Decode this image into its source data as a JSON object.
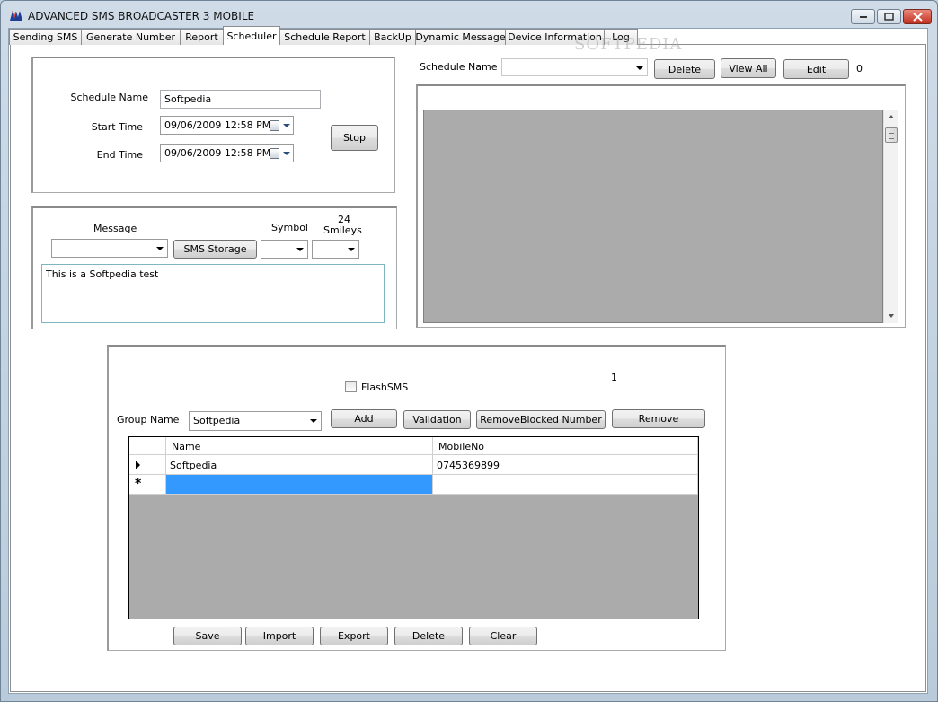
{
  "window": {
    "title": "ADVANCED SMS BROADCASTER 3 MOBILE",
    "watermark": "SOFTPEDIA"
  },
  "tabs": [
    {
      "label": "Sending SMS"
    },
    {
      "label": "Generate Number"
    },
    {
      "label": "Report"
    },
    {
      "label": "Scheduler",
      "active": true
    },
    {
      "label": "Schedule Report"
    },
    {
      "label": "BackUp"
    },
    {
      "label": "Dynamic Message"
    },
    {
      "label": "Device Information"
    },
    {
      "label": "Log"
    }
  ],
  "schedule_form": {
    "name_label": "Schedule Name",
    "name_value": "Softpedia",
    "start_label": "Start Time",
    "start_value": "09/06/2009 12:58 PM",
    "end_label": "End Time",
    "end_value": "09/06/2009 12:58 PM",
    "stop_button": "Stop"
  },
  "message_panel": {
    "message_label": "Message",
    "message_value": "",
    "sms_storage_button": "SMS Storage",
    "symbol_label": "Symbol",
    "smileys_label_line1": "24",
    "smileys_label_line2": "Smileys",
    "body_text": "This is a Softpedia test"
  },
  "schedule_list": {
    "name_label": "Schedule Name",
    "name_value": "",
    "delete_button": "Delete",
    "view_all_button": "View All",
    "edit_button": "Edit",
    "count": "0"
  },
  "recipients": {
    "count": "1",
    "flash_label": "FlashSMS",
    "flash_checked": false,
    "group_label": "Group Name",
    "group_value": "Softpedia",
    "add_button": "Add",
    "validation_button": "Validation",
    "remove_blocked_button": "RemoveBlocked Number",
    "remove_button": "Remove",
    "grid": {
      "columns": [
        "Name",
        "MobileNo"
      ],
      "rows": [
        {
          "name": "Softpedia",
          "mobile": "0745369899"
        }
      ]
    },
    "save_button": "Save",
    "import_button": "Import",
    "export_button": "Export",
    "delete_button": "Delete",
    "clear_button": "Clear"
  },
  "colors": {
    "selection": "#3399ff",
    "grid_background": "#ababab",
    "frame": "#bfcfdc"
  }
}
